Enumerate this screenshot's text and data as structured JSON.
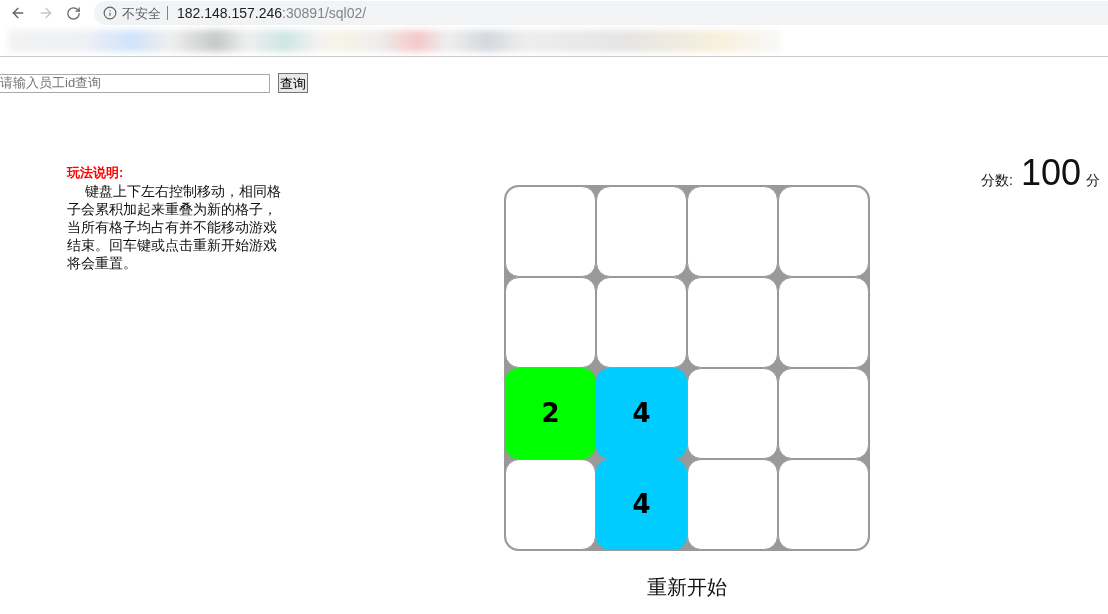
{
  "browser": {
    "back_disabled": false,
    "forward_disabled": true,
    "security_label": "不安全",
    "url_host": "182.148.157.246",
    "url_rest": ":30891/sql02/"
  },
  "search": {
    "placeholder": "请输入员工id查询",
    "button": "查询"
  },
  "instructions": {
    "title": "玩法说明:",
    "text": "键盘上下左右控制移动，相同格子会累积加起来重叠为新的格子，当所有格子均占有并不能移动游戏结束。回车键或点击重新开始游戏将会重置。"
  },
  "score": {
    "label": "分数:",
    "value": "100",
    "unit": "分"
  },
  "board": {
    "cells": [
      {
        "kind": "empty"
      },
      {
        "kind": "empty"
      },
      {
        "kind": "empty"
      },
      {
        "kind": "empty"
      },
      {
        "kind": "empty"
      },
      {
        "kind": "empty"
      },
      {
        "kind": "empty"
      },
      {
        "kind": "empty"
      },
      {
        "kind": "tile",
        "value": "2",
        "color": "#00ff00"
      },
      {
        "kind": "tile",
        "value": "4",
        "color": "#00ccff"
      },
      {
        "kind": "empty"
      },
      {
        "kind": "empty"
      },
      {
        "kind": "empty"
      },
      {
        "kind": "tile",
        "value": "4",
        "color": "#00ccff"
      },
      {
        "kind": "empty"
      },
      {
        "kind": "empty"
      }
    ]
  },
  "restart": "重新开始"
}
